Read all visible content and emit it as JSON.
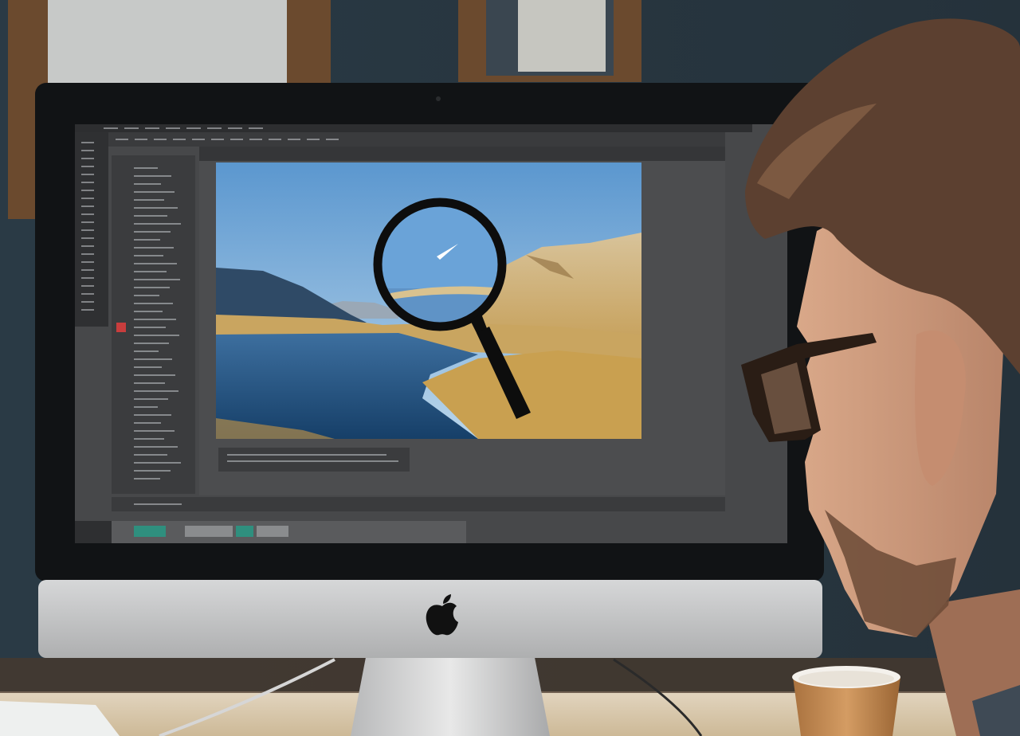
{
  "scene": {
    "description_colors": {
      "wall": "#2d3840",
      "desk": "#d9cbb4",
      "monitor_bezel": "#121416",
      "monitor_chin": "#c9cacb",
      "editor_background": "#4a4b4d",
      "panel_background": "#3a3b3d",
      "sky_top": "#5f9bd0",
      "sky_bottom": "#b7d3ea",
      "lake": "#1d4e7e",
      "hills": "#c9a560",
      "cup": "#c08a55"
    }
  },
  "monitor": {
    "logo_icon": "apple-logo-icon"
  },
  "editor": {
    "tools_icon": "toolbar-icons",
    "canvas_overlay_icon": "magnifying-glass-icon"
  }
}
